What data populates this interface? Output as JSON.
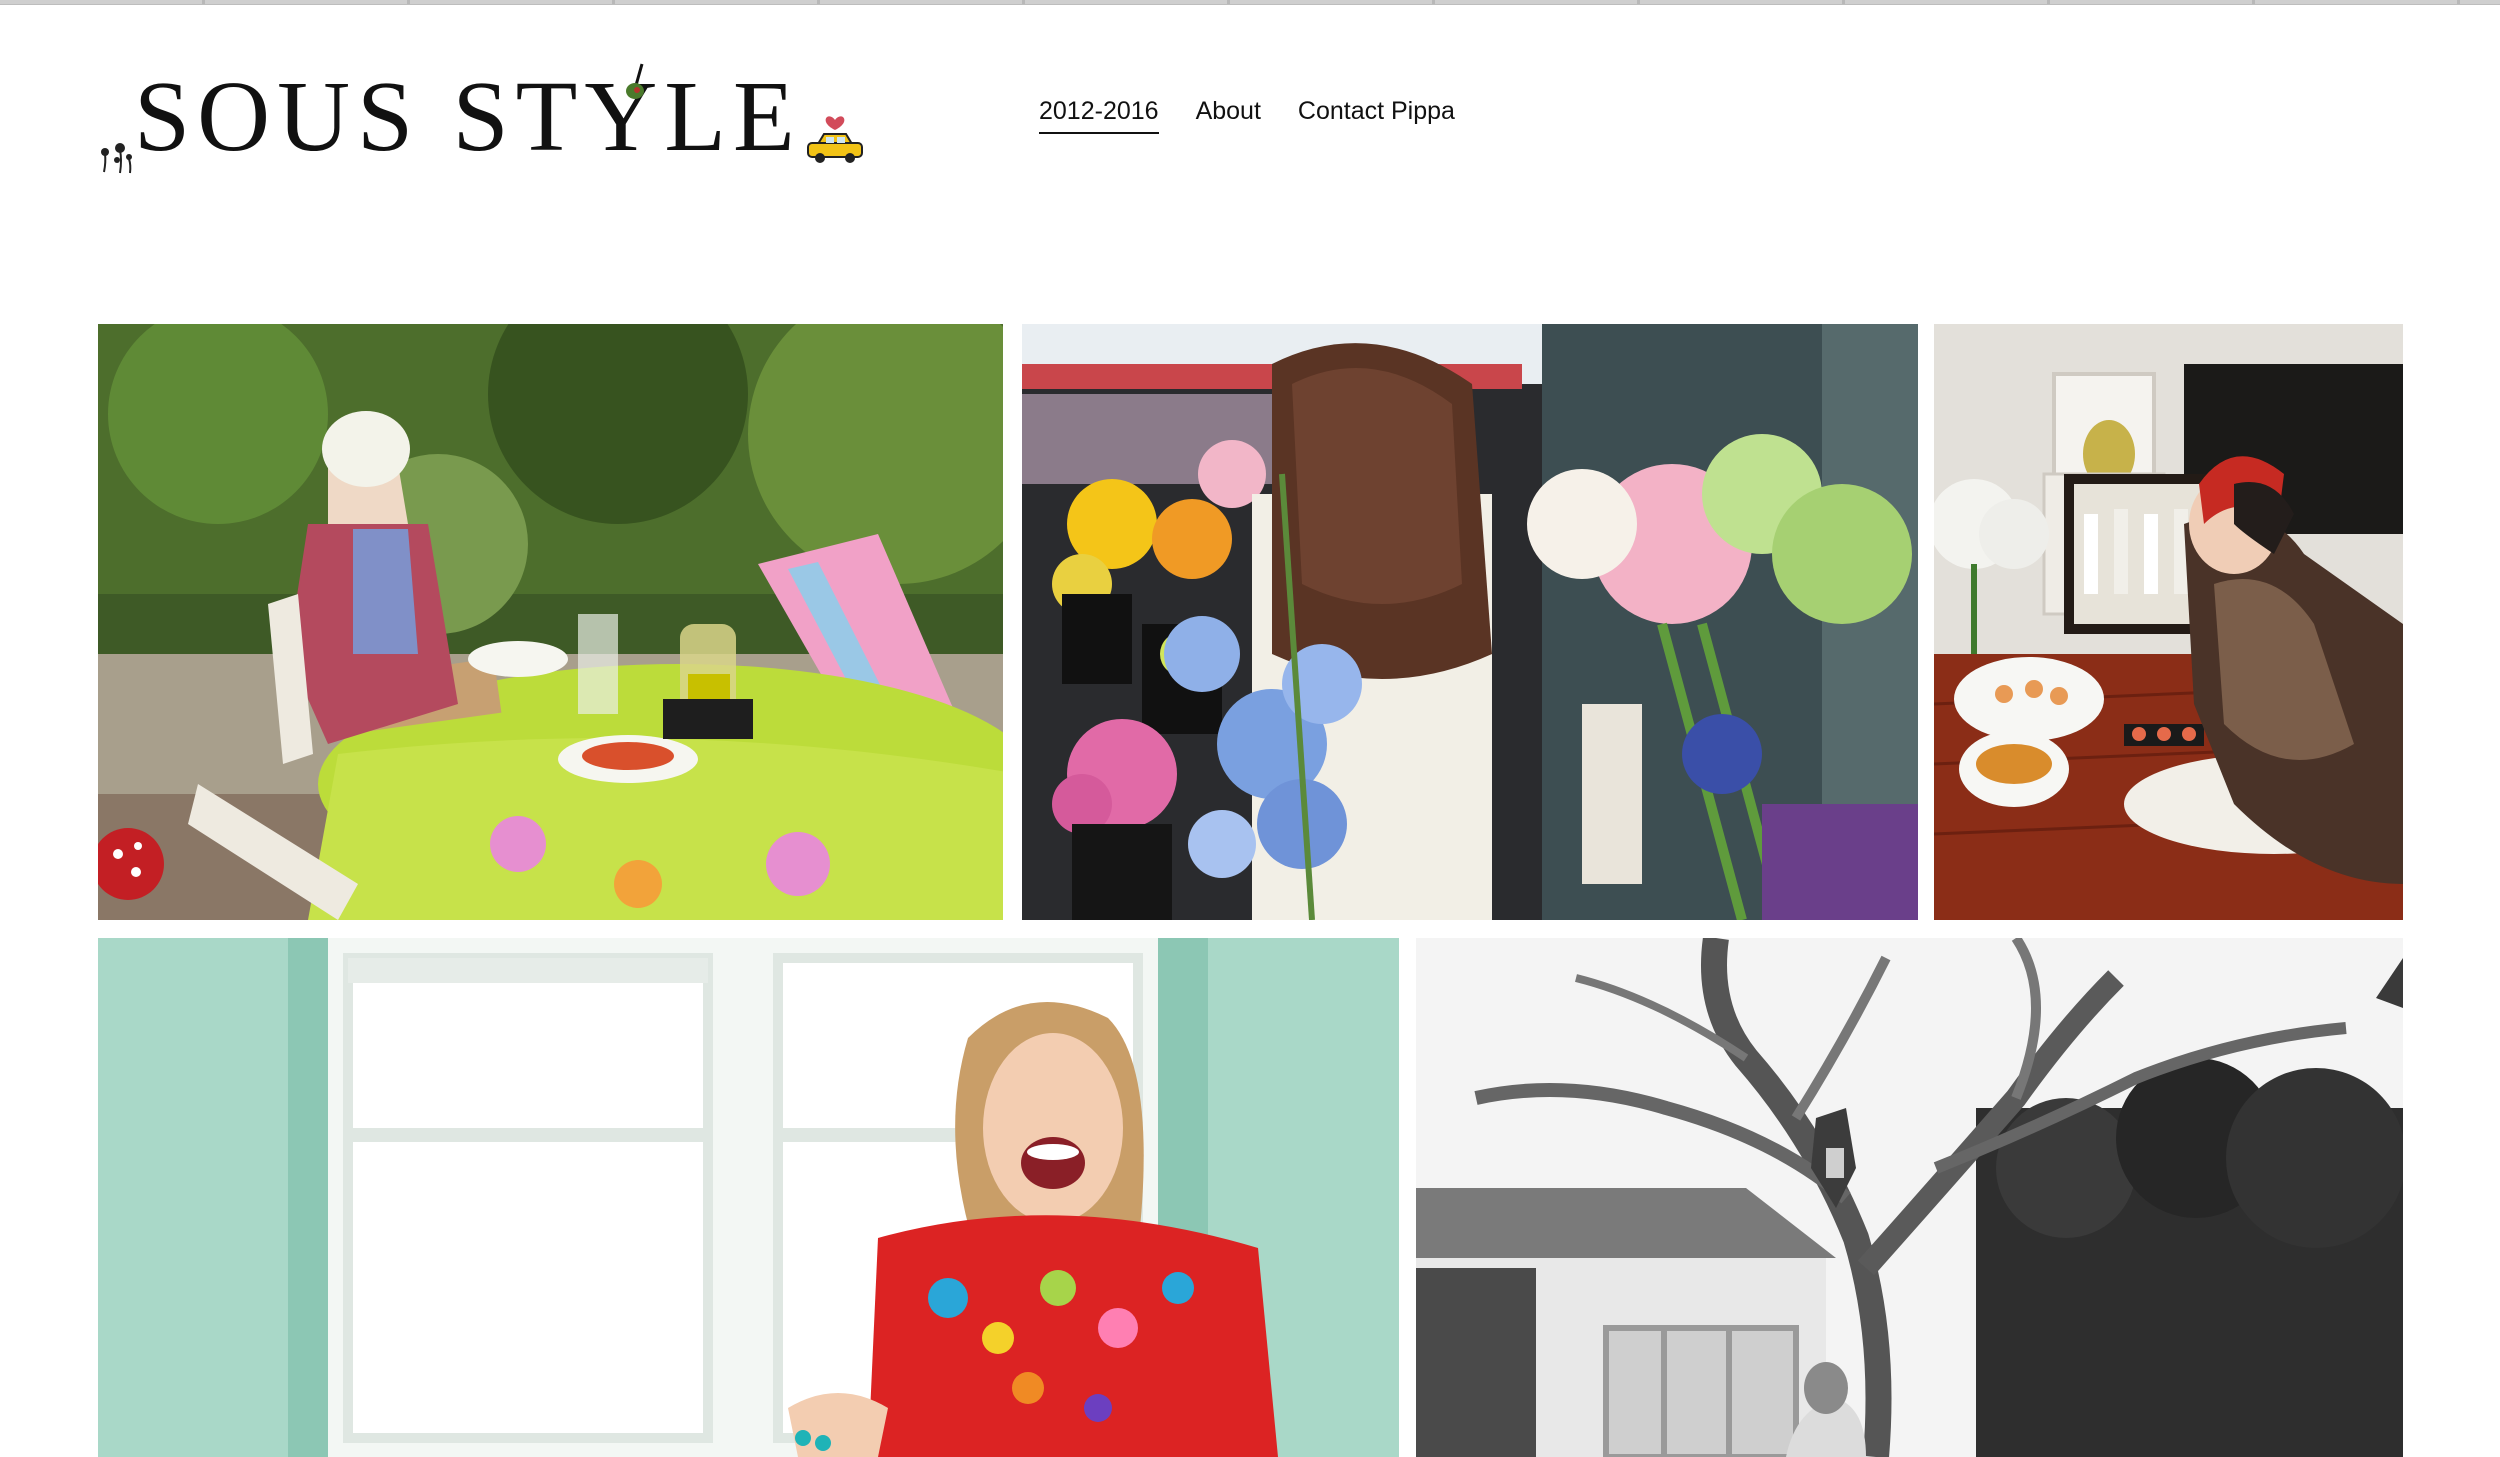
{
  "site": {
    "logo_text": "SOUS STYLE"
  },
  "nav": {
    "items": [
      {
        "label": "2012-2016",
        "active": true
      },
      {
        "label": "About",
        "active": false
      },
      {
        "label": "Contact Pippa",
        "active": false
      }
    ]
  },
  "gallery": {
    "photos": [
      {
        "caption": ""
      },
      {
        "caption": ""
      },
      {
        "caption": ""
      },
      {
        "caption": ""
      },
      {
        "caption": ""
      }
    ]
  },
  "colors": {
    "text": "#111111",
    "background": "#ffffff",
    "taxi_yellow": "#f2c316"
  }
}
